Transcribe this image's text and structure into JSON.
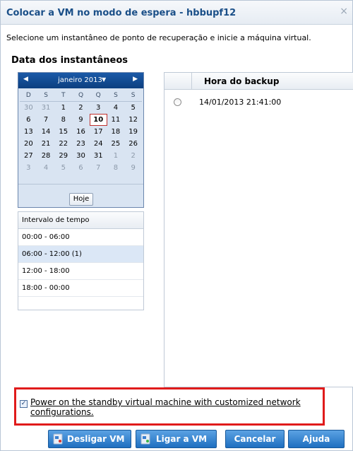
{
  "dialog": {
    "title": "Colocar a VM no modo de espera - hbbupf12",
    "close_glyph": "×",
    "instruction": "Selecione um instantâneo de ponto de recuperação e inicie a máquina virtual.",
    "section_title": "Data dos instantâneos"
  },
  "calendar": {
    "prev_glyph": "◀",
    "next_glyph": "▶",
    "month_label": "janeiro 2013",
    "caret": "▼",
    "weekdays": [
      "D",
      "S",
      "T",
      "Q",
      "Q",
      "S",
      "S"
    ],
    "days": [
      [
        "30",
        "31",
        "1",
        "2",
        "3",
        "4",
        "5"
      ],
      [
        "6",
        "7",
        "8",
        "9",
        "10",
        "11",
        "12"
      ],
      [
        "13",
        "14",
        "15",
        "16",
        "17",
        "18",
        "19"
      ],
      [
        "20",
        "21",
        "22",
        "23",
        "24",
        "25",
        "26"
      ],
      [
        "27",
        "28",
        "29",
        "30",
        "31",
        "1",
        "2"
      ],
      [
        "3",
        "4",
        "5",
        "6",
        "7",
        "8",
        "9"
      ]
    ],
    "selected_day": "10",
    "today_button": "Hoje"
  },
  "interval": {
    "header": "Intervalo de tempo",
    "rows": [
      "00:00 - 06:00",
      "06:00 - 12:00 (1)",
      "12:00 - 18:00",
      "18:00 - 00:00"
    ],
    "selected_index": 1
  },
  "backup_table": {
    "header": "Hora do backup",
    "rows": [
      {
        "time": "14/01/2013 21:41:00",
        "selected": false
      }
    ]
  },
  "power_option": {
    "checked": true,
    "check_glyph": "✓",
    "label": "Power on the standby virtual machine with customized network configurations."
  },
  "buttons": {
    "shutdown": "Desligar VM",
    "start": "Ligar a VM",
    "cancel": "Cancelar",
    "help": "Ajuda"
  },
  "colors": {
    "title_text": "#1a4f88",
    "calendar_header": "#1b5aa8",
    "button": "#2b7ccb",
    "highlight_border": "#e01b1b"
  }
}
